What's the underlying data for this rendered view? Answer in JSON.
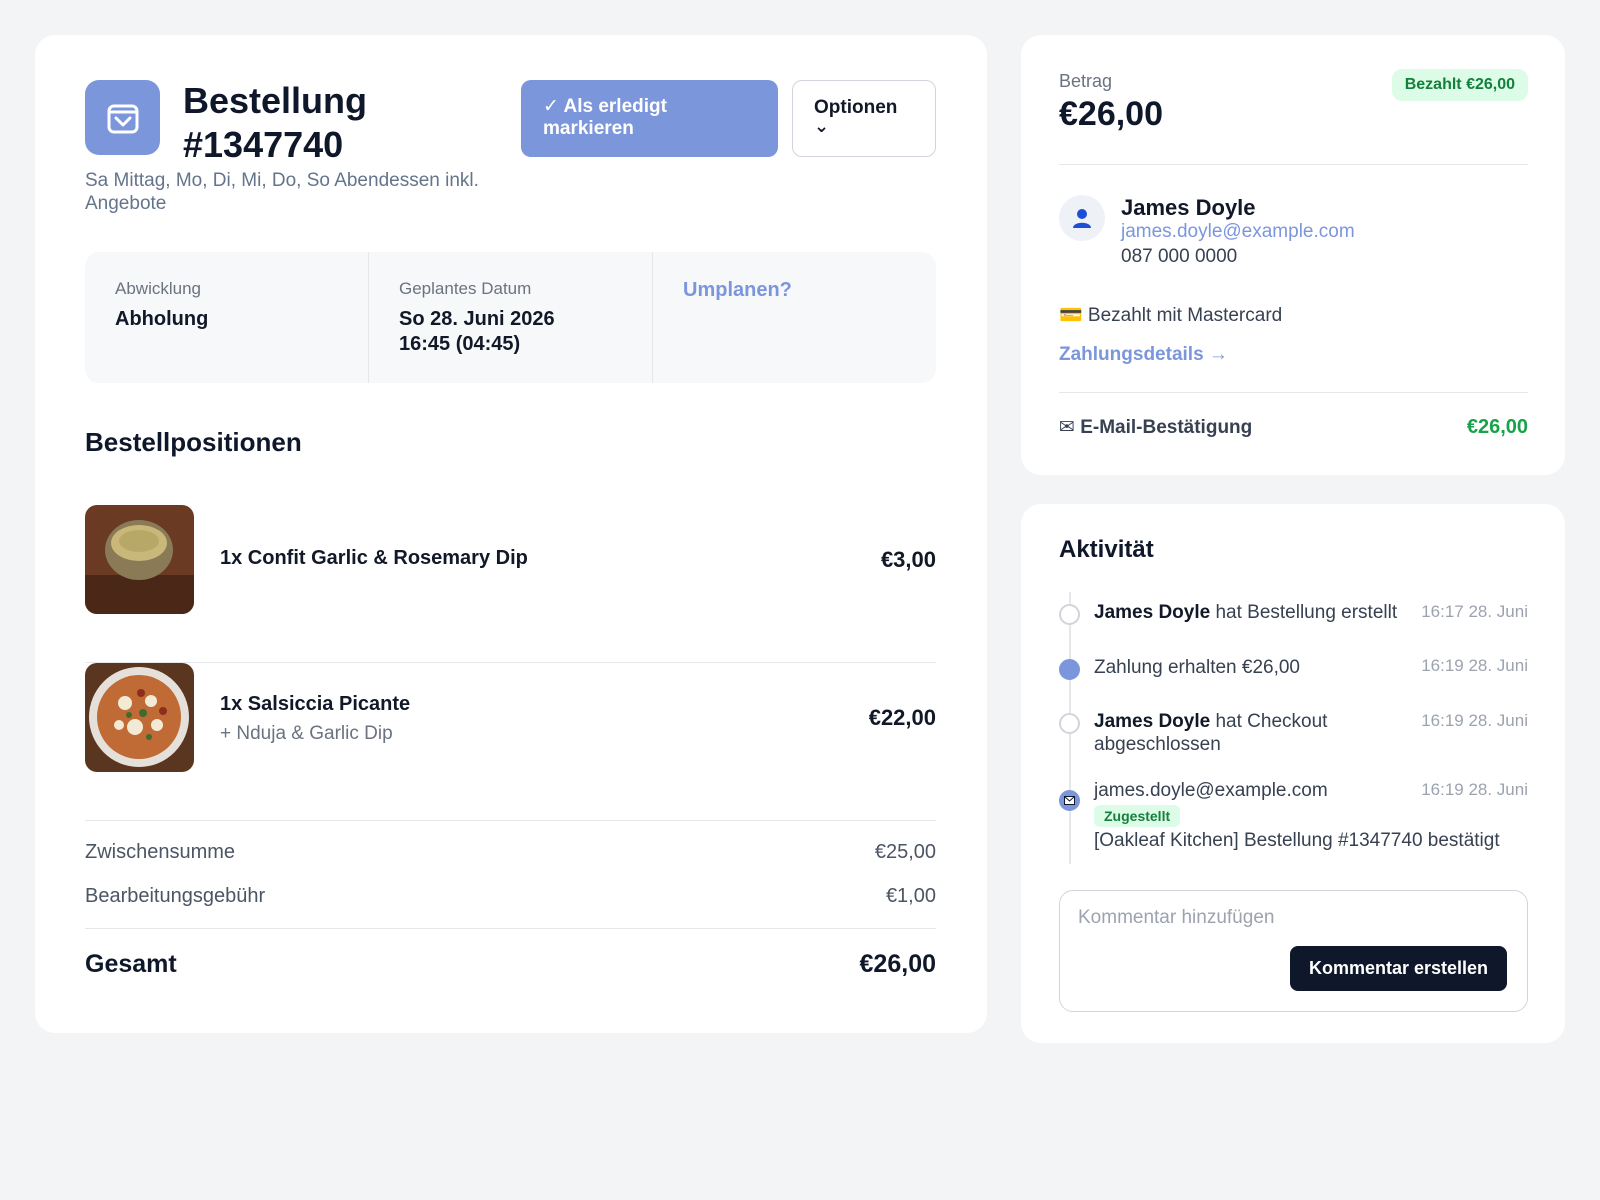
{
  "order": {
    "title": "Bestellung #1347740",
    "subtitle": "Sa Mittag, Mo, Di, Mi, Do, So Abendessen inkl. Angebote",
    "mark_done_label": "✓ Als erledigt markieren",
    "options_label": "Optionen",
    "options_chevron": "⌄",
    "icon": "shopping-bag-icon"
  },
  "info": {
    "fulfillment_label": "Abwicklung",
    "fulfillment_value": "Abholung",
    "date_label": "Geplantes Datum",
    "date_value": "So 28. Juni 2026 16:45 (04:45)",
    "reschedule_label": "Umplanen?"
  },
  "items_section": {
    "title": "Bestellpositionen",
    "items": [
      {
        "name": "1x Confit Garlic & Rosemary Dip",
        "modifier": "",
        "price": "€3,00",
        "image": "dip-image"
      },
      {
        "name": "1x Salsiccia Picante",
        "modifier": "+ Nduja & Garlic Dip",
        "price": "€22,00",
        "image": "pizza-image"
      }
    ]
  },
  "summary": {
    "subtotal_label": "Zwischensumme",
    "subtotal_value": "€25,00",
    "fee_label": "Bearbeitungsgebühr",
    "fee_value": "€1,00",
    "total_label": "Gesamt",
    "total_value": "€26,00"
  },
  "payment": {
    "amount_label": "Betrag",
    "amount_value": "€26,00",
    "status_badge": "Bezahlt €26,00",
    "customer_name": "James Doyle",
    "customer_email": "james.doyle@example.com",
    "customer_phone": "087 000 0000",
    "paid_with": "💳 Bezahlt mit Mastercard",
    "details_link": "Zahlungsdetails →",
    "email_confirmation_label": "✉ E-Mail-Bestätigung",
    "email_confirmation_amount": "€26,00"
  },
  "activity": {
    "title": "Aktivität",
    "events": [
      {
        "actor": "James Doyle",
        "text": " hat Bestellung erstellt",
        "time": "16:17 28. Juni"
      },
      {
        "actor": "",
        "text": "Zahlung erhalten €26,00",
        "time": "16:19 28. Juni"
      },
      {
        "actor": "James Doyle",
        "text": " hat Checkout abgeschlossen",
        "time": "16:19 28. Juni"
      },
      {
        "actor": "",
        "text": "james.doyle@example.com",
        "time": "16:19 28. Juni"
      }
    ],
    "email_badge": "Zugestellt",
    "email_subject": "[Oakleaf Kitchen] Bestellung #1347740 bestätigt",
    "comment_placeholder": "Kommentar hinzufügen",
    "comment_button": "Kommentar erstellen"
  },
  "colors": {
    "accent": "#7b96db",
    "success": "#16a34a",
    "dark": "#0f172a"
  }
}
